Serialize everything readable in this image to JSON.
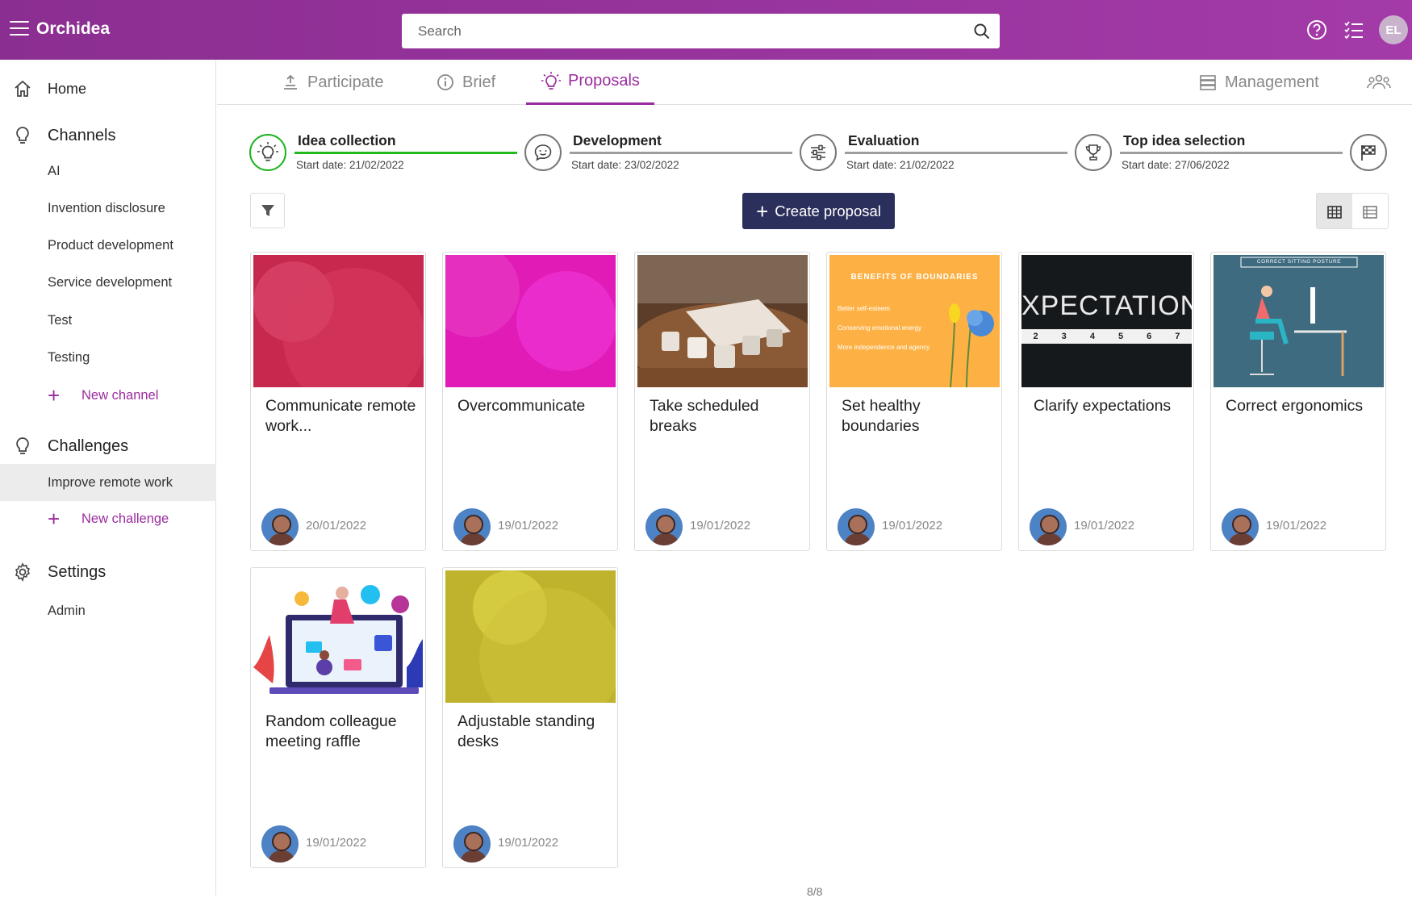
{
  "app": {
    "name": "Orchidea",
    "user_initials": "EL"
  },
  "search": {
    "placeholder": "Search"
  },
  "sidebar": {
    "home": "Home",
    "channels_title": "Channels",
    "channels": [
      "AI",
      "Invention disclosure",
      "Product development",
      "Service development",
      "Test",
      "Testing"
    ],
    "new_channel": "New channel",
    "challenges_title": "Challenges",
    "challenges": [
      "Improve remote work"
    ],
    "new_challenge": "New challenge",
    "settings_title": "Settings",
    "settings": [
      "Admin"
    ]
  },
  "tabs": {
    "participate": "Participate",
    "brief": "Brief",
    "proposals": "Proposals",
    "management": "Management",
    "active": "Proposals"
  },
  "phases": [
    {
      "title": "Idea collection",
      "date": "Start date: 21/02/2022",
      "active": true
    },
    {
      "title": "Development",
      "date": "Start date: 23/02/2022",
      "active": false
    },
    {
      "title": "Evaluation",
      "date": "Start date: 21/02/2022",
      "active": false
    },
    {
      "title": "Top idea selection",
      "date": "Start date: 27/06/2022",
      "active": false
    }
  ],
  "toolbar": {
    "create_label": "Create proposal",
    "view_mode": "grid"
  },
  "proposals": [
    {
      "title": "Communicate remote work...",
      "date": "20/01/2022",
      "thumb": "red-bubbles"
    },
    {
      "title": "Overcommunicate",
      "date": "19/01/2022",
      "thumb": "magenta-bubbles"
    },
    {
      "title": "Take scheduled breaks",
      "date": "19/01/2022",
      "thumb": "coffee-cups-photo"
    },
    {
      "title": "Set healthy boundaries",
      "date": "19/01/2022",
      "thumb": "benefits-of-boundaries-graphic"
    },
    {
      "title": "Clarify expectations",
      "date": "19/01/2022",
      "thumb": "expectation-tape-photo"
    },
    {
      "title": "Correct ergonomics",
      "date": "19/01/2022",
      "thumb": "correct-sitting-posture-graphic"
    },
    {
      "title": "Random colleague meeting raffle",
      "date": "19/01/2022",
      "thumb": "colleagues-laptop-illustration"
    },
    {
      "title": "Adjustable standing desks",
      "date": "19/01/2022",
      "thumb": "olive-bubbles"
    }
  ],
  "thumb_text": {
    "boundaries_heading": "BENEFITS OF BOUNDARIES",
    "boundaries_items": [
      "Better self-esteem",
      "Conserving emotional energy",
      "More independence and agency"
    ],
    "expectation_word": "XPECTATION",
    "tape_numbers": [
      "2",
      "3",
      "4",
      "5",
      "6",
      "7"
    ],
    "posture_heading": "CORRECT SITTING POSTURE"
  },
  "pager": "8/8",
  "colors": {
    "brand": "#9b2c9e",
    "topbar": "#8b2e91",
    "create_button": "#2b2f5b",
    "phase_active": "#20b920",
    "red_thumb": "#c7284e",
    "magenta_thumb": "#e01bb6",
    "olive_thumb": "#bfb22c",
    "orange_thumb": "#fdb144"
  }
}
